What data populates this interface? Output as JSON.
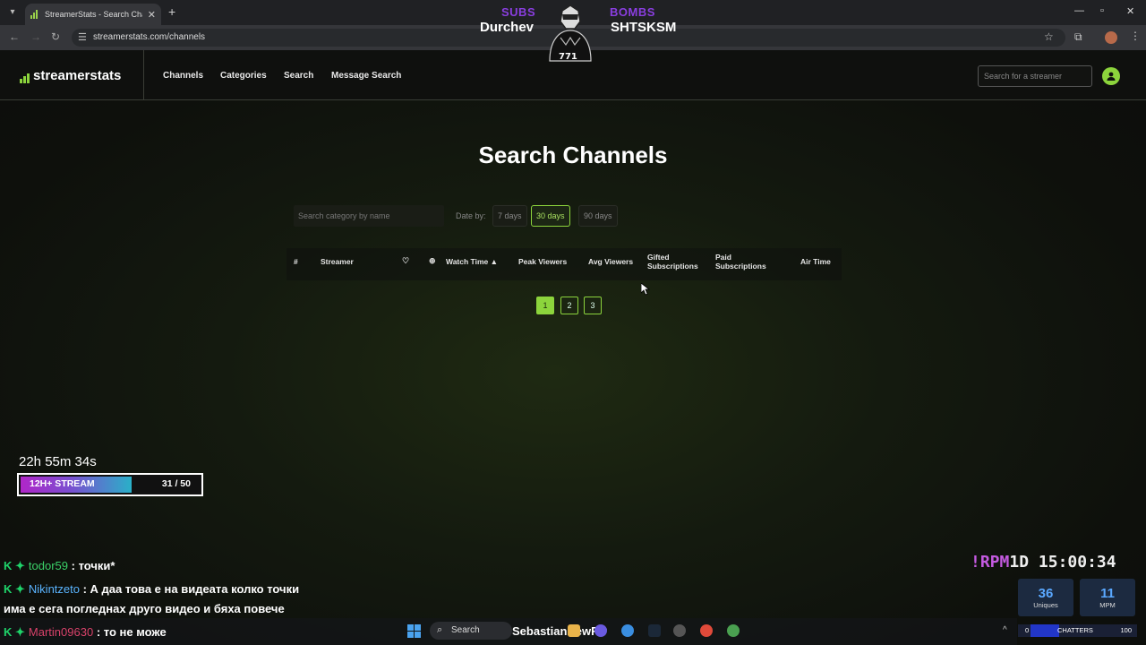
{
  "browser": {
    "tab_title": "StreamerStats - Search Channels",
    "url": "streamerstats.com/channels"
  },
  "site": {
    "logo_text": "streamerstats",
    "menu": [
      "Channels",
      "Categories",
      "Search",
      "Message Search"
    ],
    "header_search_placeholder": "Search for a streamer",
    "page_title": "Search Channels",
    "category_search_placeholder": "Search category by name",
    "date_by_label": "Date by:",
    "date_options": [
      "7 days",
      "30 days",
      "90 days"
    ],
    "date_selected": "30 days",
    "table_headers": {
      "rank": "#",
      "streamer": "Streamer",
      "watch_time": "Watch Time ▲",
      "peak_viewers": "Peak Viewers",
      "avg_viewers": "Avg Viewers",
      "gifted_1": "Gifted",
      "gifted_2": "Subscriptions",
      "paid_1": "Paid",
      "paid_2": "Subscriptions",
      "air_time": "Air Time"
    },
    "pages": [
      "1",
      "2",
      "3"
    ],
    "current_page": "1"
  },
  "overlay": {
    "subs_label": "SUBS",
    "subs_name": "Durchev",
    "bombs_label": "BOMBS",
    "bombs_name": "SHTSKSM",
    "mascot_number": "771",
    "stream_timer": "22h 55m 34s",
    "goal_label": "12H+ STREAM",
    "goal_count": "31 / 50",
    "goal_fraction": 0.62,
    "chat": [
      {
        "user": "todor59",
        "message": ": точки*"
      },
      {
        "user": "Nikintzeto",
        "message": ": А даа това е на видеата колко точки"
      },
      {
        "user": "",
        "message": "има е сега погледнах друго видео и бяха повече"
      },
      {
        "user": "Martin09630",
        "message": ": то не може"
      }
    ],
    "badge": "K ✦",
    "clock_prefix": "!RPM",
    "clock_day": "1D",
    "clock_time": "15:00:34",
    "uniques_value": "36",
    "uniques_label": "Uniques",
    "mpm_value": "11",
    "mpm_label": "MPM",
    "chatters_min": "0",
    "chatters_label": "CHATTERS",
    "chatters_max": "100"
  },
  "taskbar": {
    "search_label": "Search",
    "user_name": "SebastianNewRP"
  }
}
